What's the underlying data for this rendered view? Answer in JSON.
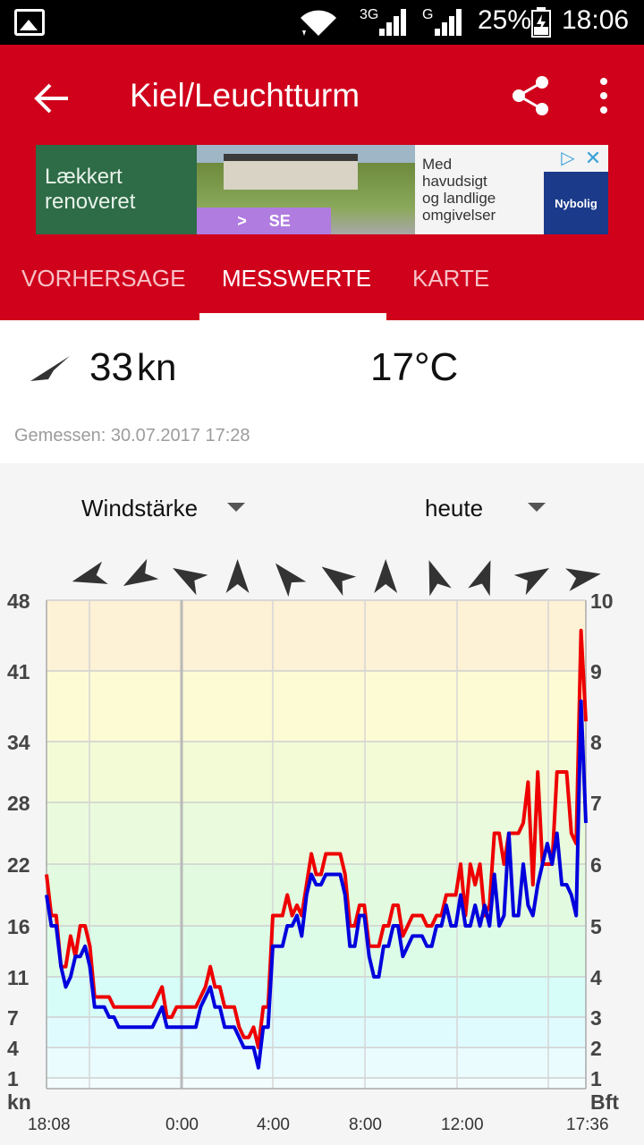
{
  "status_bar": {
    "network_3g": "3G",
    "network_g": "G",
    "battery": "25%",
    "time": "18:06"
  },
  "app_bar": {
    "title": "Kiel/Leuchtturm"
  },
  "ad": {
    "left_text_1": "Lækkert",
    "left_text_2": "renoveret",
    "se_label": "SE",
    "right_text_1": "Med",
    "right_text_2": "havudsigt",
    "right_text_3": "og landlige",
    "right_text_4": "omgivelser",
    "brand": "Nybolig"
  },
  "tabs": [
    {
      "label": "VORHERSAGE",
      "active": false
    },
    {
      "label": "MESSWERTE",
      "active": true
    },
    {
      "label": "KARTE",
      "active": false
    }
  ],
  "current": {
    "speed_value": "33",
    "speed_unit": "kn",
    "temperature": "17°C",
    "measured": "Gemessen: 30.07.2017 17:28"
  },
  "selectors": {
    "parameter": "Windstärke",
    "period": "heute"
  },
  "colors": {
    "accent": "#d0011b",
    "gust": "#ee0000",
    "mean": "#0000dd"
  },
  "chart_data": {
    "type": "line",
    "x_labels": [
      "18:08",
      "0:00",
      "4:00",
      "8:00",
      "12:00",
      "17:36"
    ],
    "y_left_unit": "kn",
    "y_right_unit": "Bft",
    "y_left_ticks": [
      1,
      4,
      7,
      11,
      16,
      22,
      28,
      34,
      41,
      48
    ],
    "y_right_ticks": [
      1,
      2,
      3,
      4,
      5,
      6,
      7,
      8,
      9,
      10
    ],
    "wind_direction_arrows": [
      255,
      240,
      300,
      0,
      320,
      305,
      0,
      340,
      20,
      60,
      80
    ],
    "series": [
      {
        "color": "#ee0000",
        "values": [
          21,
          17,
          17,
          12,
          12,
          15,
          13,
          16,
          16,
          14,
          9,
          9,
          9,
          9,
          8,
          8,
          8,
          8,
          8,
          8,
          8,
          8,
          8,
          9,
          10,
          7,
          7,
          8,
          8,
          8,
          8,
          8,
          9,
          10,
          12,
          10,
          10,
          8,
          8,
          8,
          6,
          5,
          5,
          6,
          4,
          8,
          8,
          17,
          17,
          17,
          19,
          17,
          18,
          17,
          20,
          23,
          21,
          21,
          23,
          23,
          23,
          23,
          21,
          16,
          16,
          18,
          18,
          14,
          14,
          14,
          16,
          16,
          18,
          18,
          15,
          16,
          17,
          17,
          17,
          16,
          16,
          17,
          17,
          19,
          19,
          19,
          22,
          17,
          22,
          20,
          22,
          17,
          18,
          25,
          25,
          22,
          25,
          25,
          25,
          26,
          30,
          20,
          31,
          22,
          22,
          22,
          31,
          31,
          31,
          25,
          24,
          45,
          36
        ],
        "gust": true
      },
      {
        "color": "#0000dd",
        "values": [
          19,
          16,
          16,
          12,
          10,
          11,
          13,
          13,
          14,
          12,
          8,
          8,
          8,
          7,
          7,
          6,
          6,
          6,
          6,
          6,
          6,
          6,
          6,
          7,
          8,
          6,
          6,
          6,
          6,
          6,
          6,
          6,
          8,
          9,
          10,
          8,
          8,
          6,
          6,
          6,
          5,
          4,
          4,
          4,
          2,
          6,
          6,
          14,
          14,
          14,
          16,
          16,
          17,
          15,
          19,
          21,
          20,
          20,
          21,
          21,
          21,
          21,
          19,
          14,
          14,
          17,
          17,
          13,
          11,
          11,
          14,
          14,
          16,
          16,
          13,
          14,
          15,
          15,
          15,
          14,
          14,
          16,
          16,
          18,
          16,
          16,
          19,
          16,
          16,
          18,
          16,
          18,
          16,
          21,
          16,
          17,
          25,
          17,
          17,
          22,
          18,
          17,
          20,
          22,
          24,
          22,
          25,
          20,
          20,
          19,
          17,
          38,
          26
        ],
        "gust": false
      }
    ]
  }
}
